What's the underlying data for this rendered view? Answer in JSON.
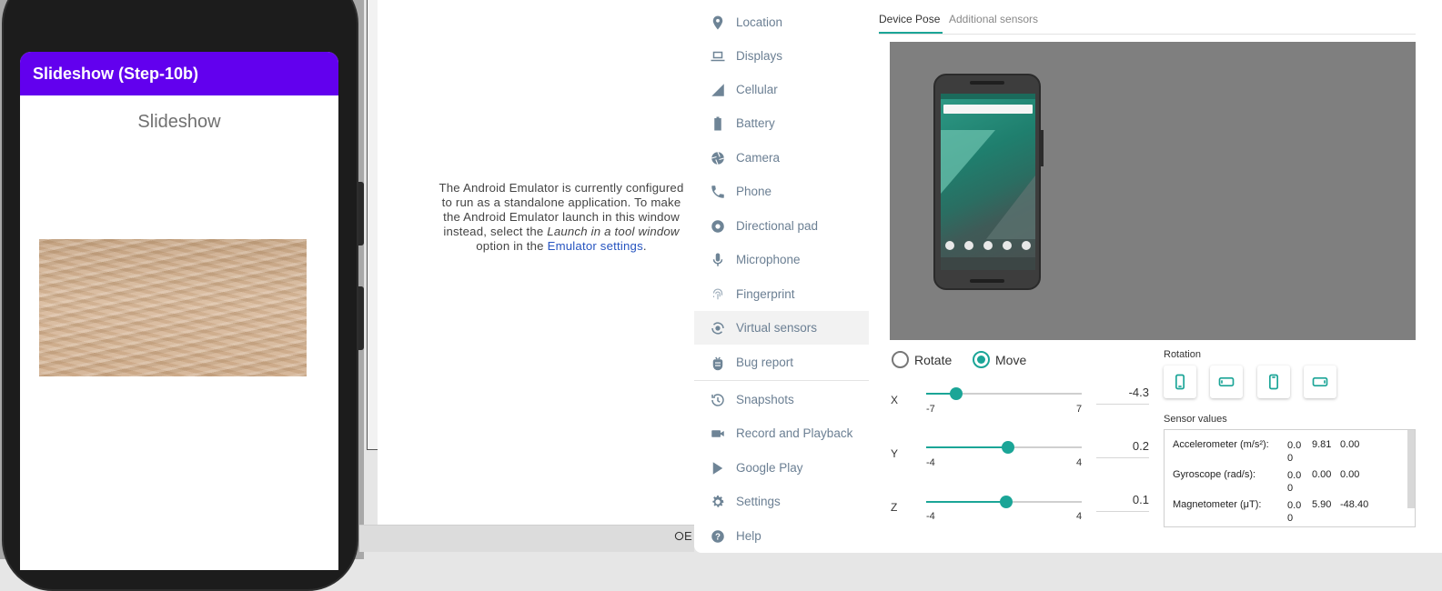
{
  "phone": {
    "app_bar_title": "Slideshow (Step-10b)",
    "slide_title": "Slideshow",
    "image_icon": "sand-image"
  },
  "toolbar": {
    "top_glyphs": [
      "×",
      "–"
    ],
    "icons": [
      "power-icon",
      "volume-up-icon",
      "volume-down-icon",
      "rotate-left-icon",
      "rotate-right-icon",
      "camera-icon",
      "zoom-icon",
      "back-icon",
      "home-icon",
      "overview-icon",
      "more-icon"
    ]
  },
  "message": {
    "text_before": "The Android Emulator is currently configured to run as a standalone application. To make the Android Emulator launch in this window instead, select the ",
    "emphasis": "Launch in a tool window",
    "text_middle": " option in the ",
    "link": "Emulator settings",
    "text_after": "."
  },
  "bottom_strip": {
    "text": "E"
  },
  "sidebar": {
    "items": [
      {
        "label": "Location",
        "icon": "location-pin-icon"
      },
      {
        "label": "Displays",
        "icon": "laptop-icon"
      },
      {
        "label": "Cellular",
        "icon": "signal-icon"
      },
      {
        "label": "Battery",
        "icon": "battery-icon"
      },
      {
        "label": "Camera",
        "icon": "camera-aperture-icon"
      },
      {
        "label": "Phone",
        "icon": "phone-icon"
      },
      {
        "label": "Directional pad",
        "icon": "dpad-icon"
      },
      {
        "label": "Microphone",
        "icon": "microphone-icon"
      },
      {
        "label": "Fingerprint",
        "icon": "fingerprint-icon"
      },
      {
        "label": "Virtual sensors",
        "icon": "sensors-icon",
        "active": true
      },
      {
        "label": "Bug report",
        "icon": "bug-icon"
      },
      {
        "label": "Snapshots",
        "icon": "history-icon"
      },
      {
        "label": "Record and Playback",
        "icon": "video-icon"
      },
      {
        "label": "Google Play",
        "icon": "play-store-icon"
      },
      {
        "label": "Settings",
        "icon": "gear-icon"
      },
      {
        "label": "Help",
        "icon": "help-icon"
      }
    ]
  },
  "panel": {
    "tabs": [
      {
        "label": "Device Pose",
        "active": true
      },
      {
        "label": "Additional sensors",
        "active": false
      }
    ],
    "mode": {
      "rotate_label": "Rotate",
      "move_label": "Move",
      "selected": "Move"
    },
    "sliders": [
      {
        "axis": "X",
        "min": "-7",
        "max": "7",
        "value": "-4.3",
        "min_num": -7,
        "max_num": 7,
        "num": -4.3
      },
      {
        "axis": "Y",
        "min": "-4",
        "max": "4",
        "value": "0.2",
        "min_num": -4,
        "max_num": 4,
        "num": 0.2
      },
      {
        "axis": "Z",
        "min": "-4",
        "max": "4",
        "value": "0.1",
        "min_num": -4,
        "max_num": 4,
        "num": 0.1
      }
    ],
    "rotation_label": "Rotation",
    "rotation_buttons": [
      "portrait-icon",
      "landscape-icon",
      "reverse-portrait-icon",
      "reverse-landscape-icon"
    ],
    "sensor_values_label": "Sensor values",
    "sensor_values": [
      {
        "name": "Accelerometer (m/s²):",
        "v1": "0.00",
        "v2": "9.81",
        "v3": "0.00"
      },
      {
        "name": "Gyroscope (rad/s):",
        "v1": "0.00",
        "v2": "0.00",
        "v3": "0.00"
      },
      {
        "name": "Magnetometer (μT):",
        "v1": "0.00",
        "v2": "5.90",
        "v3": "-48.40"
      }
    ]
  },
  "colors": {
    "accent": "#1ba597",
    "app_bar": "#6200ee",
    "link": "#2755c0"
  }
}
